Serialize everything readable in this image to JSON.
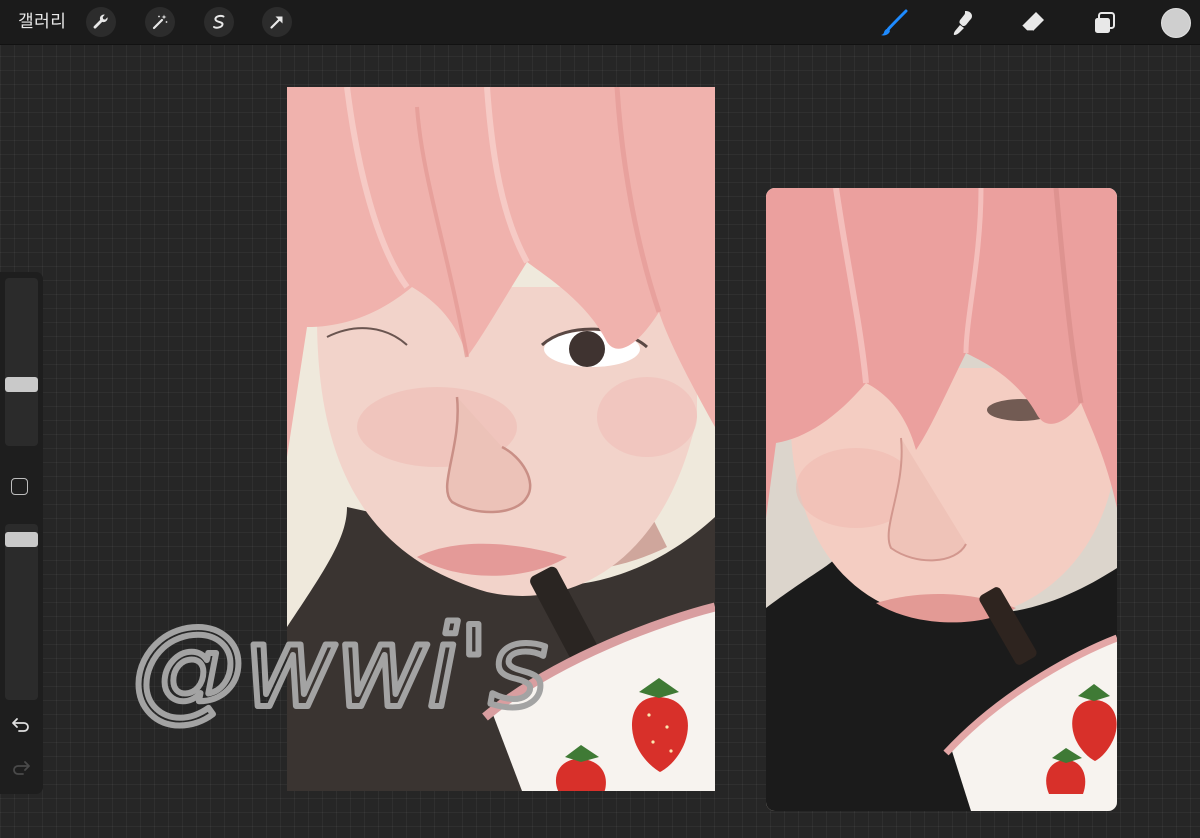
{
  "topbar": {
    "gallery_label": "갤러리",
    "left_tools": [
      "wrench-icon",
      "magic-wand-icon",
      "selection-icon",
      "transform-arrow-icon"
    ],
    "right_tools": [
      "brush-icon",
      "smudge-icon",
      "eraser-icon",
      "layers-icon"
    ],
    "active_tool": "brush-icon",
    "accent_color": "#1e8bff",
    "current_color": "#cfcfcf"
  },
  "sidebar": {
    "brush_size_level": 0.35,
    "opacity_level": 0.95,
    "modify_button": "square-modify-icon",
    "undo": "undo-icon",
    "redo": "redo-icon"
  },
  "canvas": {
    "watermark_text": "@wwi's",
    "watermark_color": "#a3a3a3",
    "artwork": {
      "hair_color": "#f0b2ad",
      "skin_color": "#f2d3ca",
      "jacket_color": "#3a3431",
      "cup_color": "#f7f3ef",
      "strawberry_color": "#d8302a"
    },
    "photo": {
      "hair_color": "#eba09e",
      "skin_color": "#f4cdc2",
      "jacket_color": "#1b1b1b"
    }
  }
}
